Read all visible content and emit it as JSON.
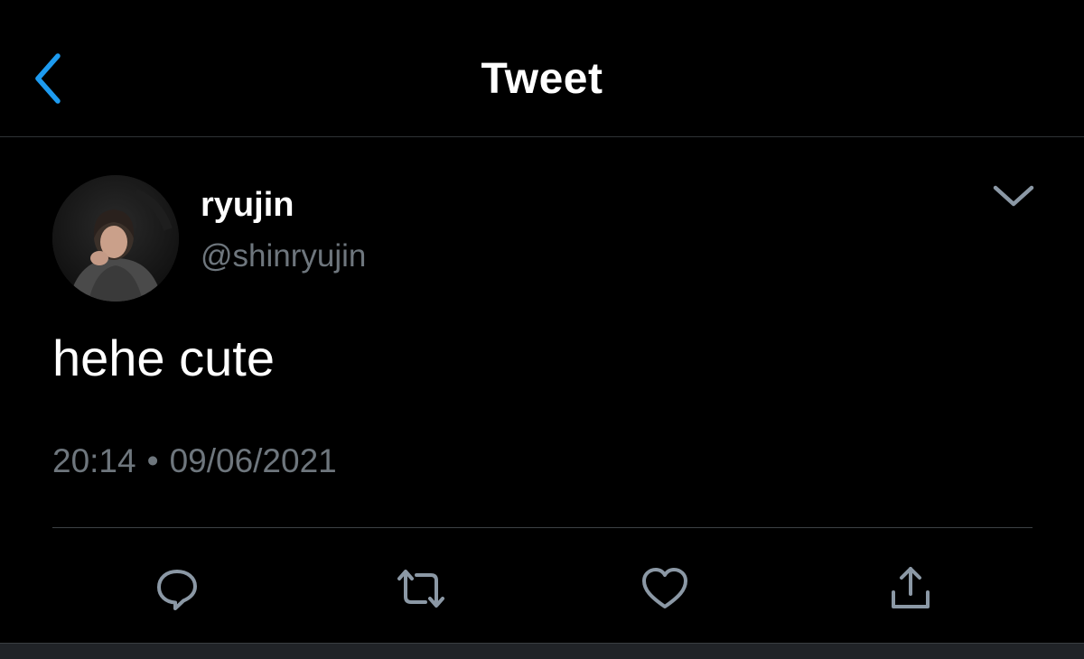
{
  "header": {
    "title": "Tweet",
    "back_icon": "chevron-left-icon"
  },
  "tweet": {
    "display_name": "ryujin",
    "handle": "@shinryujin",
    "text": "hehe cute",
    "time": "20:14",
    "separator": "•",
    "date": "09/06/2021"
  },
  "actions": [
    {
      "icon": "reply-icon"
    },
    {
      "icon": "retweet-icon"
    },
    {
      "icon": "like-icon"
    },
    {
      "icon": "share-icon"
    }
  ],
  "colors": {
    "background": "#000000",
    "accent": "#1d9bf0",
    "secondary_text": "#6e767d",
    "icon": "#8b98a5"
  }
}
